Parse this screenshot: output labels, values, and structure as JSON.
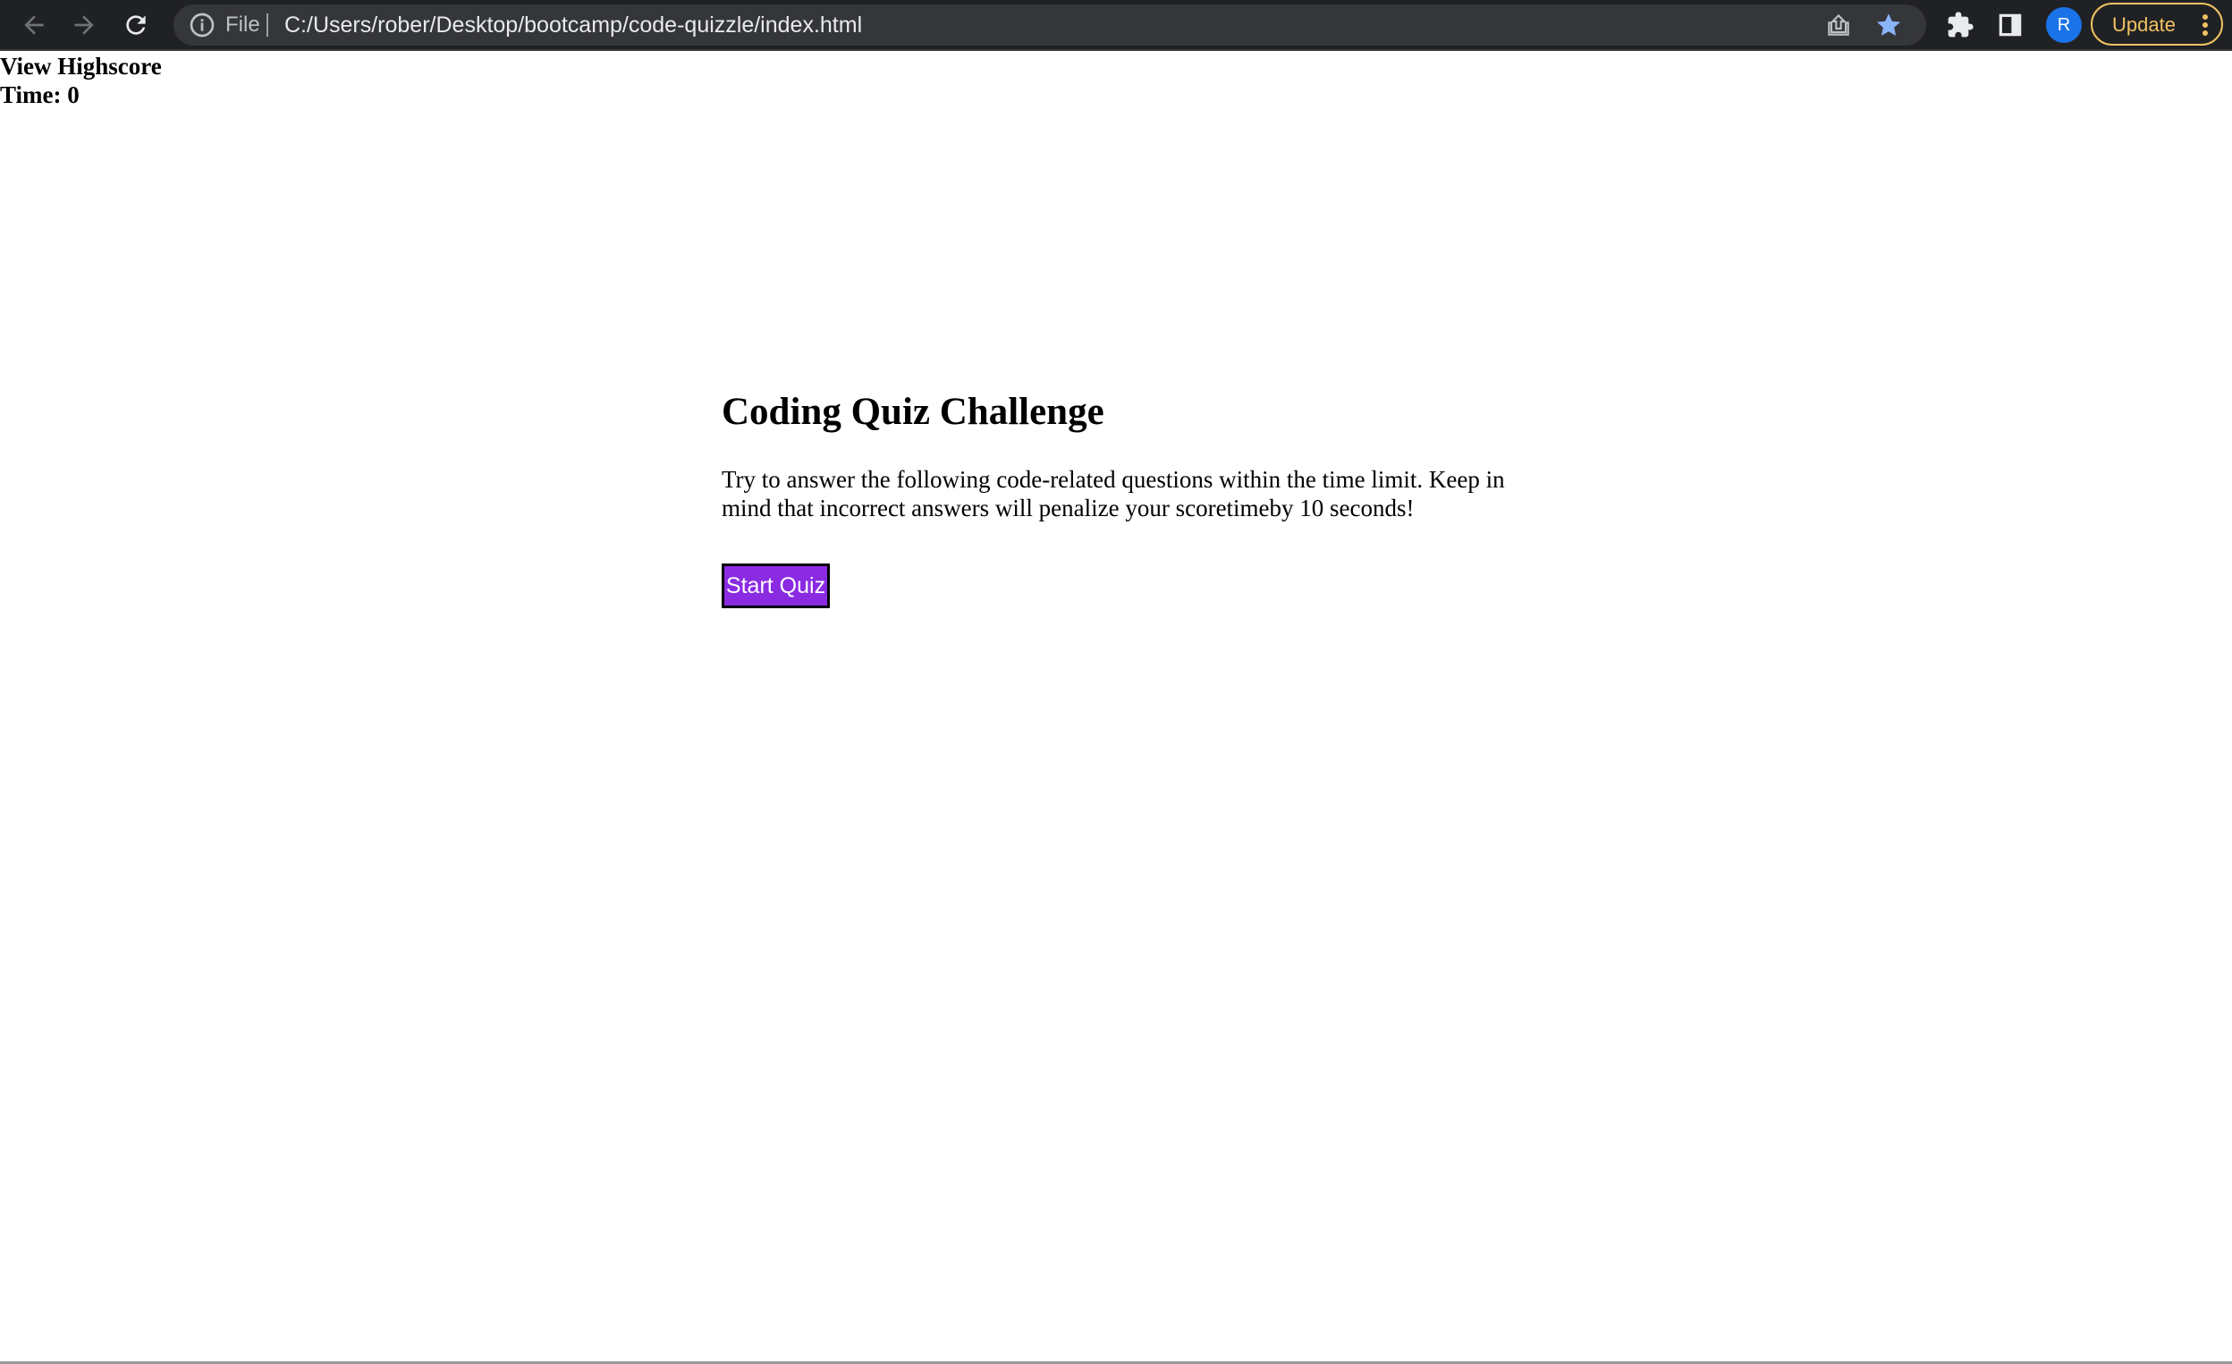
{
  "browser": {
    "file_label": "File",
    "url": "C:/Users/rober/Desktop/bootcamp/code-quizzle/index.html",
    "profile_initial": "R",
    "update_label": "Update",
    "icons": [
      "back-arrow-icon",
      "forward-arrow-icon",
      "reload-icon",
      "info-icon",
      "share-icon",
      "star-icon",
      "puzzle-icon",
      "side-panel-icon",
      "more-vert-icon"
    ],
    "colors": {
      "toolbar_bg": "#202124",
      "omnibox_bg": "#35363a",
      "star": "#8ab4f8",
      "update_accent": "#f0c262",
      "avatar_bg": "#1a73e8"
    }
  },
  "header": {
    "highscore_link": "View Highscore",
    "time_label": "Time: 0"
  },
  "quiz": {
    "title": "Coding Quiz Challenge",
    "description": "Try to answer the following code-related questions within the time limit. Keep in mind that incorrect answers will penalize your scoretimeby 10 seconds!",
    "start_button": "Start Quiz",
    "button_color": "#8a2be2"
  }
}
